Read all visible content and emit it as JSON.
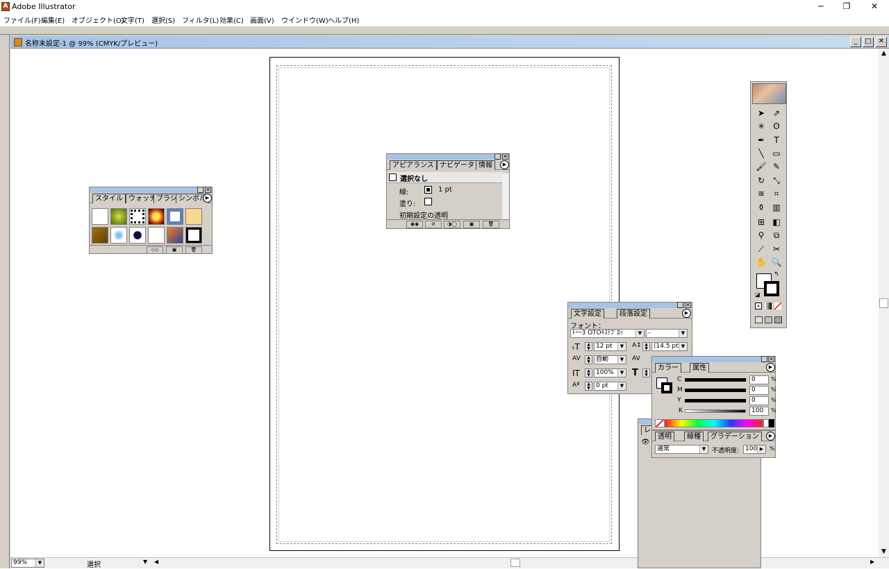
{
  "app": {
    "title": "Adobe Illustrator",
    "icon": "illustrator-app-icon"
  },
  "window_controls": {
    "minimize": "─",
    "restore": "❐",
    "close": "✕"
  },
  "menu": [
    "ファイル(F)",
    "編集(E)",
    "オブジェクト(O)",
    "文字(T)",
    "選択(S)",
    "フィルタ(L)",
    "効果(C)",
    "画面(V)",
    "ウインドウ(W)",
    "ヘルプ(H)"
  ],
  "document": {
    "title": "名称未設定-1 @ 99% (CMYK/プレビュー)"
  },
  "status": {
    "zoom": "99%",
    "mode": "選択"
  },
  "styles_panel": {
    "tabs": [
      "スタイル",
      "ウォッチ",
      "ブラシ",
      "シンボル"
    ]
  },
  "appearance_panel": {
    "tabs": [
      "アピアランス",
      "ナビゲータ",
      "情報"
    ],
    "header": "選択なし",
    "stroke_label": "線:",
    "stroke_value": "1 pt",
    "fill_label": "塗り:",
    "opacity_label": "初期設定の透明"
  },
  "character_panel": {
    "tabs": [
      "文字設定",
      "段落設定"
    ],
    "font_label": "フォント：",
    "font_value": "ﾄｰｰ3 OTOｷｽﾃﾌﾟﾛｯ",
    "style_value": "-",
    "size": "12 pt",
    "leading": "(14.5 pt)",
    "kerning": "自動",
    "scale": "100%",
    "baseline": "0 pt"
  },
  "color_panel": {
    "tabs": [
      "カラー",
      "属性"
    ],
    "channels": [
      {
        "label": "C",
        "value": "0"
      },
      {
        "label": "M",
        "value": "0"
      },
      {
        "label": "Y",
        "value": "0"
      },
      {
        "label": "K",
        "value": "100"
      }
    ],
    "percent": "%"
  },
  "transparency_panel": {
    "tabs": [
      "透明",
      "線種",
      "グラデーション"
    ],
    "blend_mode": "通常",
    "opacity_label": "不透明度:",
    "opacity_value": "100",
    "percent": "%"
  },
  "layers_panel": {
    "tab": "レ"
  }
}
